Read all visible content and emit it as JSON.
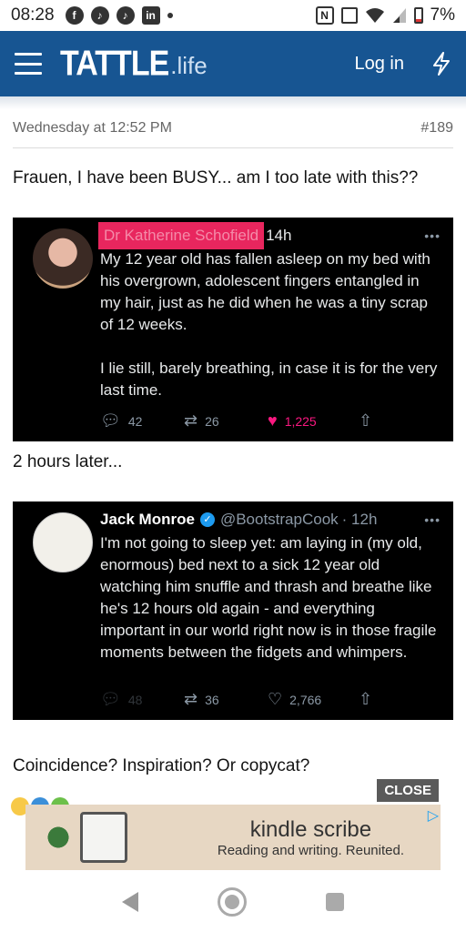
{
  "status_bar": {
    "time": "08:28",
    "battery": "7%",
    "icons": [
      "facebook-icon",
      "tiktok-icon",
      "tiktok-icon",
      "linkedin-icon",
      "nfc-icon",
      "vibrate-icon",
      "wifi-icon",
      "signal-icon",
      "battery-icon"
    ]
  },
  "header": {
    "logo_main": "TATTLE",
    "logo_sub": ".life",
    "login": "Log in",
    "bg_color": "#175592"
  },
  "post": {
    "date": "Wednesday at 12:52 PM",
    "number": "#189",
    "intro": "Frauen, I have been BUSY... am I too late with this??",
    "between": "2 hours later...",
    "closing": "Coincidence? Inspiration? Or copycat?"
  },
  "tweet1": {
    "name": "Dr Katherine Schofield",
    "time": "14h",
    "text": "My 12 year old has fallen asleep on my bed with his overgrown, adolescent fingers entangled in my hair, just as he did when he was a tiny scrap of 12 weeks.\n\nI lie still, barely breathing, in case it is for the very last time.",
    "replies": "42",
    "retweets": "26",
    "likes": "1,225"
  },
  "tweet2": {
    "name": "Jack Monroe",
    "handle": "@BootstrapCook",
    "time": "· 12h",
    "text": "I'm not going to sleep yet: am laying in (my old, enormous) bed next to a sick 12 year old watching him snuffle and thrash and breathe like he's 12 hours old again - and everything important in our world right now is in those fragile moments between the fidgets and whimpers.",
    "replies": "48",
    "retweets": "36",
    "likes": "2,766"
  },
  "ad": {
    "close": "CLOSE",
    "title": "kindle scribe",
    "subtitle": "Reading and writing. Reunited."
  }
}
